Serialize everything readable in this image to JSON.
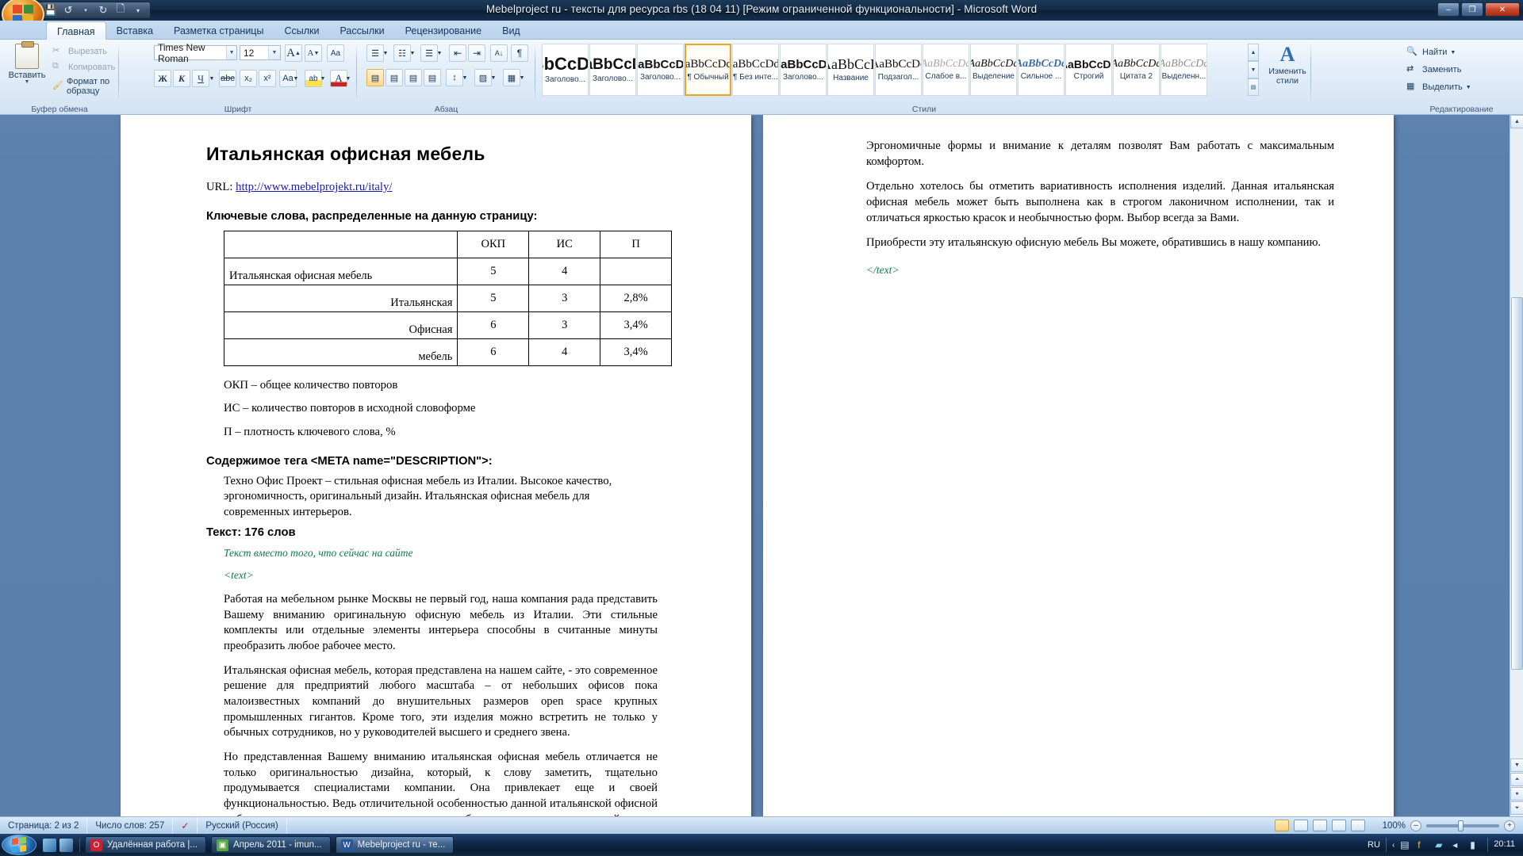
{
  "window": {
    "title": "Mebelproject ru - тексты для ресурса rbs (18 04 11) [Режим ограниченной функциональности]  -  Microsoft Word",
    "minimize": "–",
    "maximize": "❐",
    "close": "✕"
  },
  "quick_access": {
    "save": "💾",
    "undo": "↺",
    "redo": "↻",
    "new": "🗋",
    "customize": "▾"
  },
  "tabs": [
    {
      "label": "Главная",
      "active": true
    },
    {
      "label": "Вставка",
      "active": false
    },
    {
      "label": "Разметка страницы",
      "active": false
    },
    {
      "label": "Ссылки",
      "active": false
    },
    {
      "label": "Рассылки",
      "active": false
    },
    {
      "label": "Рецензирование",
      "active": false
    },
    {
      "label": "Вид",
      "active": false
    }
  ],
  "ribbon": {
    "clipboard": {
      "group_label": "Буфер обмена",
      "paste_label": "Вставить",
      "cut": "Вырезать",
      "copy": "Копировать",
      "format_painter": "Формат по образцу"
    },
    "font": {
      "group_label": "Шрифт",
      "font_name": "Times New Roman",
      "font_size": "12",
      "grow": "A",
      "shrink": "A",
      "clear_format": "Aa",
      "bold": "Ж",
      "italic": "К",
      "underline": "Ч",
      "strikethrough": "abc",
      "subscript": "x₂",
      "superscript": "x²",
      "change_case": "Aa",
      "highlight": "ab",
      "font_color": "A"
    },
    "paragraph": {
      "group_label": "Абзац",
      "bullets": "☰",
      "numbering": "☷",
      "multilevel": "☰",
      "decrease_indent": "⇤",
      "increase_indent": "⇥",
      "sort": "A↓",
      "show_marks": "¶",
      "align_left": "▤",
      "align_center": "▤",
      "align_right": "▤",
      "align_justify": "▤",
      "line_spacing": "↕",
      "shading": "▨",
      "borders": "▦"
    },
    "styles": {
      "group_label": "Стили",
      "change_styles_label": "Изменить стили",
      "items": [
        {
          "preview": "AaBbCcDdEe",
          "name": "Заголово...",
          "selected": false,
          "look": "h1"
        },
        {
          "preview": "AaBbCcDd",
          "name": "Заголово...",
          "selected": false,
          "look": "h2"
        },
        {
          "preview": "AaBbCcDd",
          "name": "Заголово...",
          "selected": false,
          "look": "h3"
        },
        {
          "preview": "AaBbCcDdE",
          "name": "¶ Обычный",
          "selected": true,
          "look": "normal"
        },
        {
          "preview": "AaBbCcDdE",
          "name": "¶ Без инте...",
          "selected": false,
          "look": "normal"
        },
        {
          "preview": "AaBbCcDd",
          "name": "Заголово...",
          "selected": false,
          "look": "h4"
        },
        {
          "preview": "AaBbCcD",
          "name": "Название",
          "selected": false,
          "look": "title"
        },
        {
          "preview": "AaBbCcDd",
          "name": "Подзагол...",
          "selected": false,
          "look": "sub"
        },
        {
          "preview": "AaBbCcDd",
          "name": "Слабое в...",
          "selected": false,
          "look": "subtle"
        },
        {
          "preview": "AaBbCcDd",
          "name": "Выделение",
          "selected": false,
          "look": "emph"
        },
        {
          "preview": "AaBbCcDd",
          "name": "Сильное ...",
          "selected": false,
          "look": "strong"
        },
        {
          "preview": "AaBbCcDd",
          "name": "Строгий",
          "selected": false,
          "look": "intense"
        },
        {
          "preview": "AaBbCcDd",
          "name": "Цитата 2",
          "selected": false,
          "look": "quote"
        },
        {
          "preview": "AaBbCcDd",
          "name": "Выделенн...",
          "selected": false,
          "look": "subtle2"
        }
      ],
      "scroll_up": "▲",
      "scroll_down": "▼",
      "scroll_more": "▤"
    },
    "editing": {
      "group_label": "Редактирование",
      "find": "Найти",
      "replace": "Заменить",
      "select": "Выделить"
    }
  },
  "document": {
    "heading": "Итальянская офисная мебель",
    "url_label": "URL:",
    "url_value": "http://www.mebelprojekt.ru/italy/",
    "keywords_heading": "Ключевые слова, распределенные на данную страницу:",
    "table": {
      "headers": [
        "",
        "ОКП",
        "ИС",
        "П"
      ],
      "rows": [
        {
          "label": "Италья нская офисная мебель",
          "label_text": "Итальянская офисная мебель",
          "align": "left",
          "okp": "5",
          "is": "4",
          "p": ""
        },
        {
          "label_text": "Итальянская",
          "align": "right",
          "okp": "5",
          "is": "3",
          "p": "2,8%"
        },
        {
          "label_text": "Офисная",
          "align": "right",
          "okp": "6",
          "is": "3",
          "p": "3,4%"
        },
        {
          "label_text": "мебель",
          "align": "right",
          "okp": "6",
          "is": "4",
          "p": "3,4%"
        }
      ]
    },
    "legend": [
      "ОКП – общее количество повторов",
      "ИС – количество повторов в исходной словоформе",
      "П – плотность ключевого слова, %"
    ],
    "meta_heading": "Содержимое тега <META name=\"DESCRIPTION\">:",
    "meta_text": "Техно Офис Проект – стильная офисная мебель из Италии. Высокое качество, эргономичность, оригинальный дизайн. Итальянская офисная мебель для современных интерьеров.",
    "text_heading": "Текст: 176 слов",
    "note_green": "Текст вместо того, что сейчас на сайте",
    "tag_open": "<text>",
    "tag_close": "</text>",
    "paragraphs": [
      "Работая на мебельном рынке Москвы не первый год, наша компания рада представить Вашему вниманию оригинальную офисную мебель из Италии. Эти стильные комплекты или отдельные элементы интерьера способны в считанные минуты преобразить любое рабочее место.",
      "Итальянская офисная мебель, которая представлена на нашем сайте, - это современное решение для предприятий любого масштаба – от небольших офисов пока малоизвестных компаний до внушительных размеров open space крупных промышленных гигантов. Кроме того, эти изделия можно встретить не только у обычных сотрудников, но у руководителей высшего и среднего звена.",
      "Но представленная Вашему вниманию итальянская офисная мебель отличается не только оригинальностью дизайна, который, к слову заметить, тщательно продумывается специалистами компании. Она привлекает еще и своей функциональностью. Ведь отличительной особенностью данной итальянской офисной мебели является продуманность конструкции мебельных элементов до мелочей."
    ],
    "page2_paragraphs": [
      "Эргономичные формы и внимание к деталям позволят Вам работать с максимальным комфортом.",
      "Отдельно хотелось бы отметить вариативность исполнения изделий. Данная итальянская офисная мебель может быть выполнена как в строгом лаконичном исполнении, так и отличаться яркостью красок и необычностью форм. Выбор всегда за Вами.",
      "Приобрести эту итальянскую офисную мебель Вы можете, обратившись в нашу компанию."
    ]
  },
  "statusbar": {
    "page": "Страница: 2 из 2",
    "words": "Число слов: 257",
    "proofing_icon": "spellcheck-icon",
    "language": "Русский (Россия)",
    "zoom_value": "100%",
    "zoom_out": "–",
    "zoom_in": "+"
  },
  "taskbar": {
    "start": "start-orb",
    "quick_launch": [
      "show-desktop-icon",
      "switch-window-icon"
    ],
    "tasks": [
      {
        "label": "Удалённая работа |...",
        "active": false,
        "icon_color": "#cf2030",
        "icon_glyph": "O"
      },
      {
        "label": "Апрель 2011 - imun...",
        "active": false,
        "icon_color": "#57a83c",
        "icon_glyph": "▣"
      },
      {
        "label": "Mebelproject ru - те...",
        "active": true,
        "icon_color": "#2a5699",
        "icon_glyph": "W"
      }
    ],
    "tray": {
      "language": "RU",
      "show_hidden": "‹",
      "icons": [
        "network-icon",
        "volume-icon",
        "flash-icon",
        "shield-icon",
        "battery-icon"
      ],
      "time": "20:11"
    }
  }
}
